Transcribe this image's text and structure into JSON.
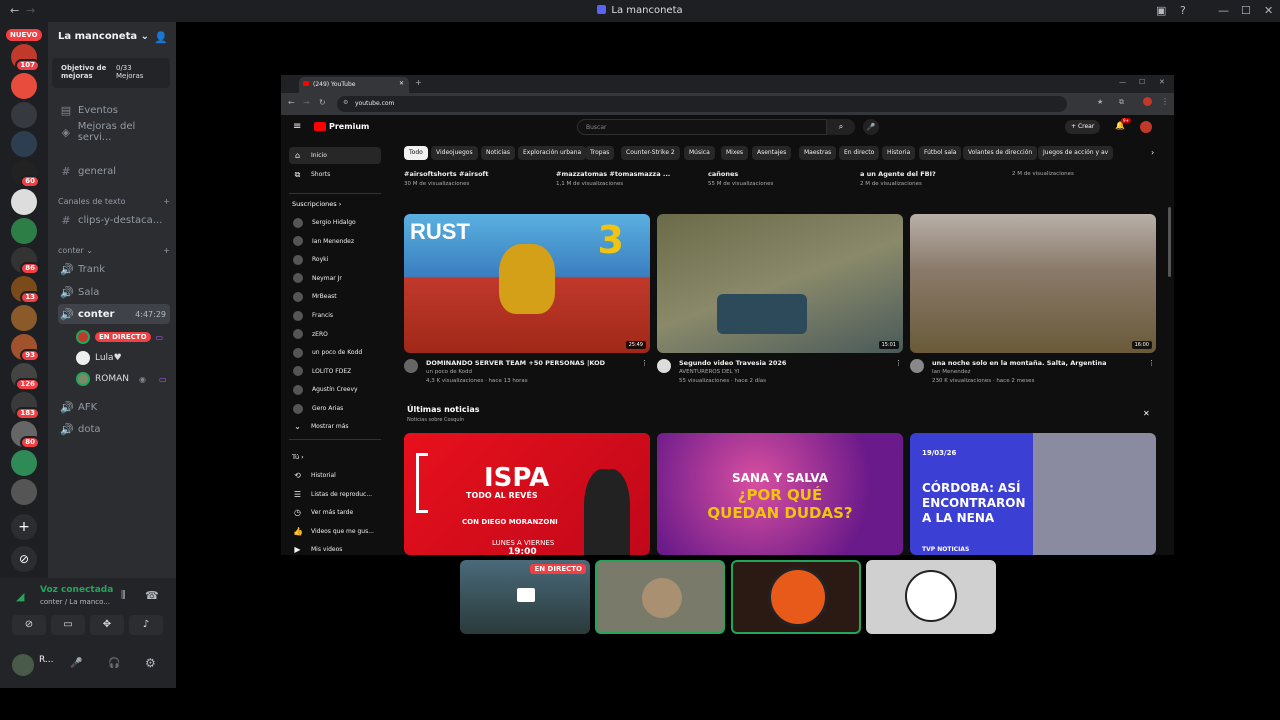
{
  "window": {
    "title": "La manconeta",
    "nav_back": "←",
    "nav_forward": "→"
  },
  "rail": {
    "new_label": "NUEVO",
    "servers": [
      {
        "badge": "107",
        "color": "#c0392b"
      },
      {
        "badge": "",
        "color": "#e74c3c"
      },
      {
        "badge": "",
        "color": "#36393f"
      },
      {
        "badge": "",
        "color": "#2c3e50"
      },
      {
        "badge": "60",
        "color": "#222"
      },
      {
        "badge": "",
        "color": "#ddd"
      },
      {
        "badge": "",
        "color": "#2d7d46"
      },
      {
        "badge": "86",
        "color": "#333"
      },
      {
        "badge": "13",
        "color": "#7a4a1a"
      },
      {
        "badge": "",
        "color": "#8b5a2b"
      },
      {
        "badge": "93",
        "color": "#a0522d"
      },
      {
        "badge": "126",
        "color": "#444"
      },
      {
        "badge": "183",
        "color": "#3a3a3a"
      },
      {
        "badge": "80",
        "color": "#666"
      },
      {
        "badge": "",
        "color": "#2e8b57"
      },
      {
        "badge": "",
        "color": "#555"
      }
    ]
  },
  "server": {
    "name": "La manconeta",
    "boost_goal": "Objetivo de mejoras",
    "boost_count": "0/33 Mejoras",
    "events": "Eventos",
    "best_of": "Mejoras del servi...",
    "general": "general",
    "text_category": "Canales de texto",
    "clips": "clips-y-destaca...",
    "voice_category": "conter",
    "channels": [
      "Trank",
      "Sala"
    ],
    "active_channel": "conter",
    "active_time": "4:47:29",
    "live_badge": "EN DIRECTO",
    "users": [
      "Lula♥",
      "ROMAN"
    ],
    "extra_channels": [
      "AFK",
      "dota"
    ]
  },
  "voice_panel": {
    "status": "Voz conectada",
    "location": "conter / La manco...",
    "user_initial": "R..."
  },
  "browser": {
    "tab_title": "(249) YouTube",
    "url": "youtube.com"
  },
  "youtube": {
    "logo": "Premium",
    "search_placeholder": "Buscar",
    "create": "Crear",
    "notif_count": "9+",
    "chips": [
      "Todo",
      "Videojuegos",
      "Noticias",
      "Exploración urbana",
      "Tropas",
      "Counter-Strike 2",
      "Música",
      "Mixes",
      "Asentajes",
      "Maestras",
      "En directo",
      "Historia",
      "Fútbol sala",
      "Volantes de dirección",
      "Juegos de acción y av"
    ],
    "sidebar_main": [
      "Inicio",
      "Shorts"
    ],
    "subs_header": "Suscripciones",
    "subs": [
      "Sergio Hidalgo",
      "Ian Menendez",
      "Royki",
      "Neymar Jr",
      "MrBeast",
      "Francis",
      "zERO",
      "un poco de Kodd",
      "LOLITO FDEZ",
      "Agustín Creevy",
      "Gero Arias"
    ],
    "show_more": "Mostrar más",
    "you_header": "Tú",
    "you_items": [
      "Historial",
      "Listas de reproduc...",
      "Ver más tarde",
      "Videos que me gus...",
      "Mis videos"
    ],
    "top_row": [
      {
        "title": "#airsoftshorts #airsoft",
        "meta": "30 M de visualizaciones"
      },
      {
        "title": "#mazzatomas #tomasmazza ...",
        "meta": "1,1 M de visualizaciones"
      },
      {
        "title": "cañones",
        "meta": "55 M de visualizaciones"
      },
      {
        "title": "a un Agente del FBI?",
        "meta": "2 M de visualizaciones"
      },
      {
        "title": "",
        "meta": "2 M de visualizaciones"
      }
    ],
    "videos": [
      {
        "title": "DOMINANDO SERVER TEAM +50 PERSONAS |KOD",
        "channel": "un poco de Kodd",
        "stats": "4,3 K visualizaciones · hace 13 horas",
        "duration": "25:49",
        "thumb_text": "RUST",
        "thumb_num": "3"
      },
      {
        "title": "Segundo video Travesia 2026",
        "channel": "AVENTUREROS DEL YI",
        "stats": "55 visualizaciones · hace 2 días",
        "duration": "15:01"
      },
      {
        "title": "una noche solo en la montaña. Salta, Argentina",
        "channel": "Ian Menendez",
        "stats": "230 K visualizaciones · hace 2 meses",
        "duration": "16:00"
      }
    ],
    "news_title": "Últimas noticias",
    "news_sub": "Noticias sobre Cosquín",
    "news": [
      {
        "line1": "ISPA",
        "line2": "TODO AL REVÉS",
        "line3": "CON DIEGO MORANZONI",
        "line4": "LUNES A VIERNES",
        "line5": "19:00"
      },
      {
        "line1": "SANA Y SALVA",
        "line2": "¿POR QUÉ",
        "line3": "QUEDAN DUDAS?"
      },
      {
        "date": "19/03/26",
        "line1": "CÓRDOBA: ASÍ",
        "line2": "ENCONTRARON",
        "line3": "A LA NENA",
        "tag": "TVP NOTICIAS"
      }
    ]
  },
  "tiles": {
    "live_badge": "EN DIRECTO"
  }
}
